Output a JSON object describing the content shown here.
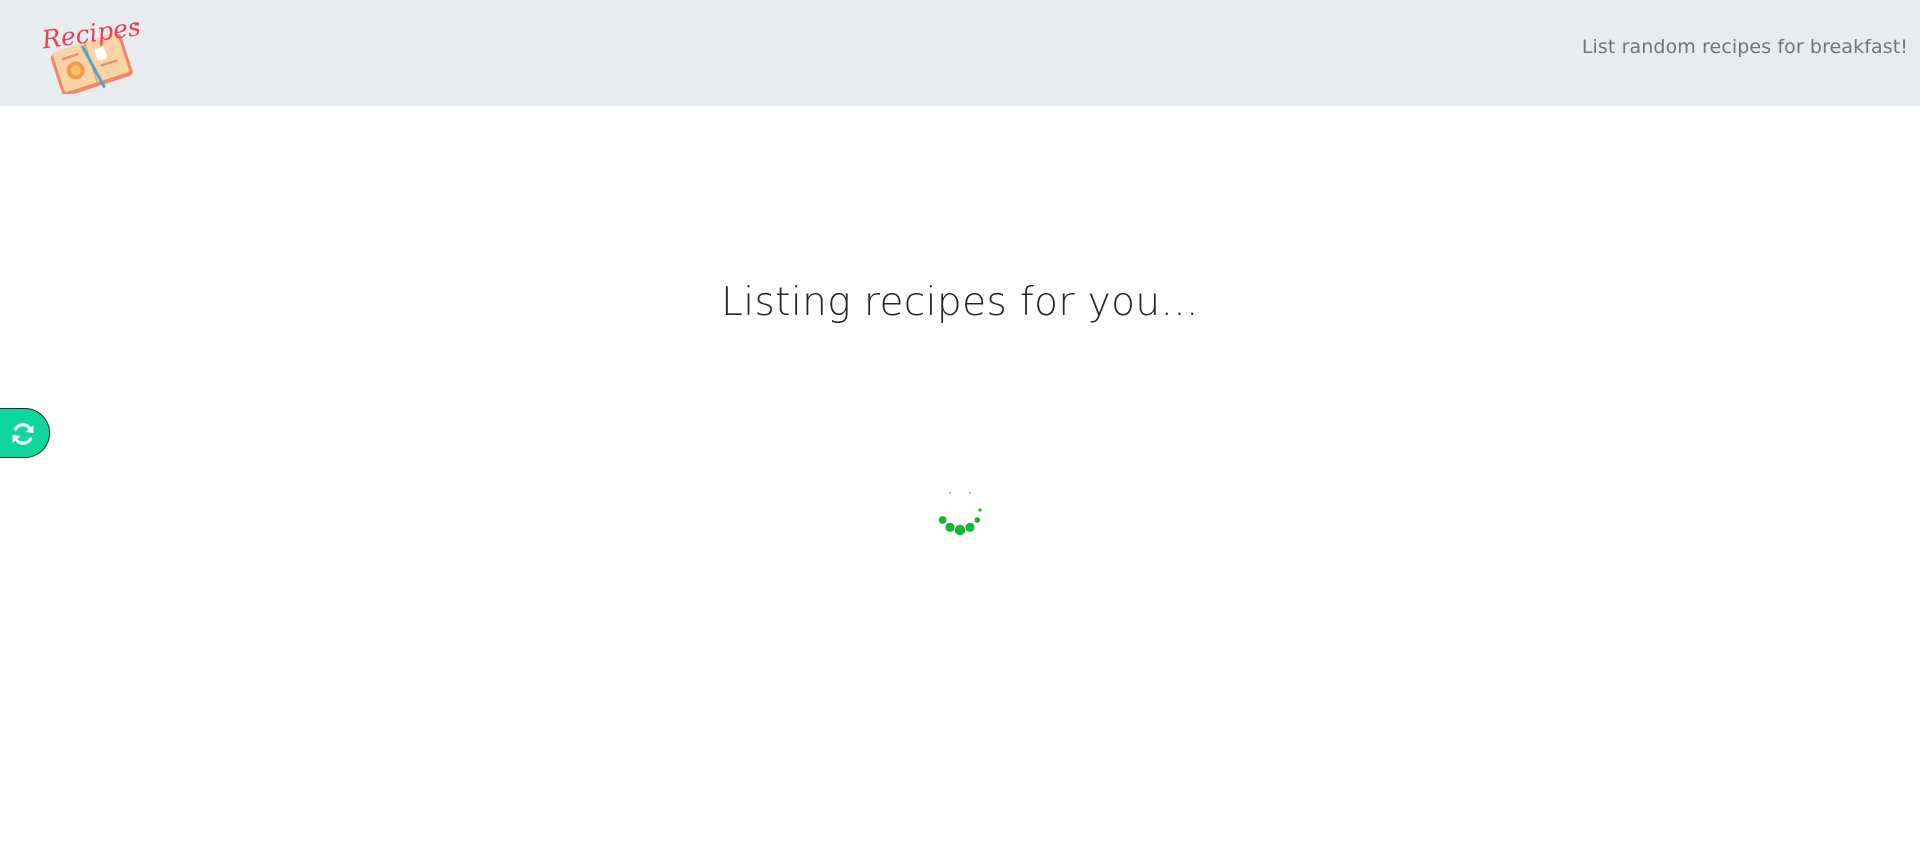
{
  "navbar": {
    "logo_text": "Recipes",
    "link_label": "List random recipes for breakfast!"
  },
  "main": {
    "heading": "Listing recipes for you..."
  },
  "icons": {
    "logo": "recipe-book-logo",
    "refresh": "refresh-icon",
    "spinner": "loading-spinner"
  },
  "colors": {
    "navbar_bg": "#e8ecef",
    "accent_green": "#0fd69a",
    "spinner_green": "#14b82e"
  }
}
